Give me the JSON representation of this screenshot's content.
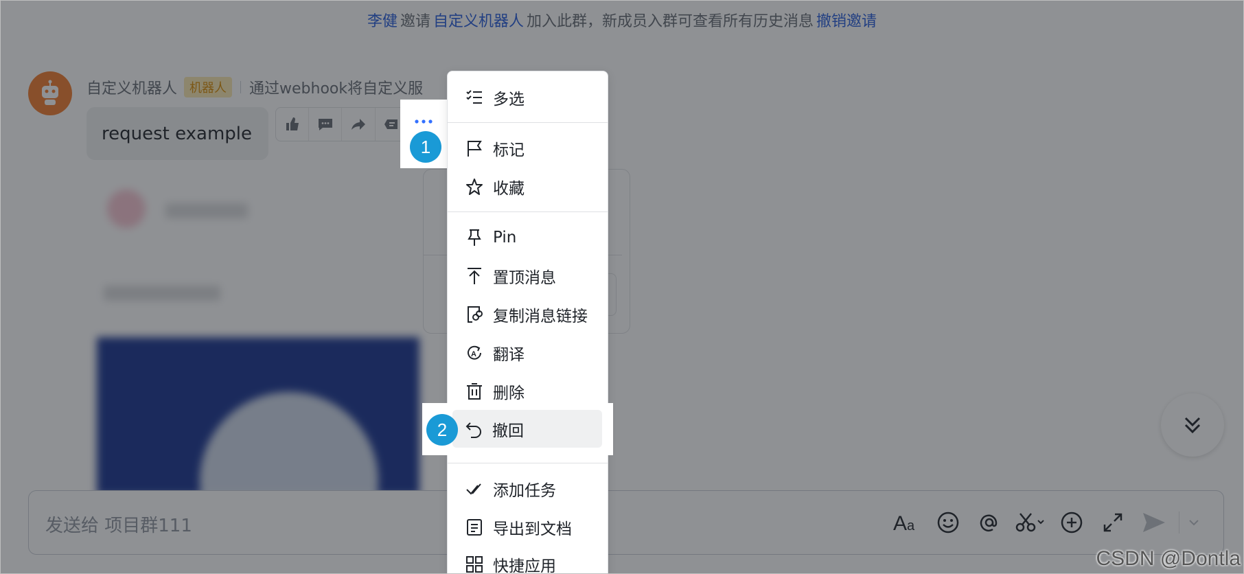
{
  "notice": {
    "inviter": "李健",
    "verb": "邀请",
    "invitee": "自定义机器人",
    "text": "加入此群，新成员入群可查看所有历史消息",
    "action": "撤销邀请"
  },
  "message": {
    "sender": "自定义机器人",
    "badge": "机器人",
    "description": "通过webhook将自定义服",
    "text": "request example"
  },
  "menu": {
    "items": [
      {
        "label": "多选",
        "icon": "multi-select-icon"
      },
      {
        "label": "标记",
        "icon": "flag-icon"
      },
      {
        "label": "收藏",
        "icon": "star-icon"
      },
      {
        "label": "Pin",
        "icon": "pin-icon"
      },
      {
        "label": "置顶消息",
        "icon": "pin-top-icon"
      },
      {
        "label": "复制消息链接",
        "icon": "link-icon"
      },
      {
        "label": "翻译",
        "icon": "translate-icon"
      },
      {
        "label": "删除",
        "icon": "trash-icon"
      },
      {
        "label": "撤回",
        "icon": "undo-icon"
      },
      {
        "label": "添加任务",
        "icon": "task-icon"
      },
      {
        "label": "导出到文档",
        "icon": "document-icon"
      },
      {
        "label": "快捷应用",
        "icon": "apps-icon"
      }
    ]
  },
  "composer": {
    "placeholder": "发送给 项目群111"
  },
  "steps": {
    "one": "1",
    "two": "2"
  },
  "watermark": "CSDN @Dontla",
  "colors": {
    "link": "#245bdb",
    "step": "#1a9ad6",
    "badge_bg": "#fbe9b0",
    "badge_text": "#d98a00",
    "avatar": "#f07b2c"
  }
}
